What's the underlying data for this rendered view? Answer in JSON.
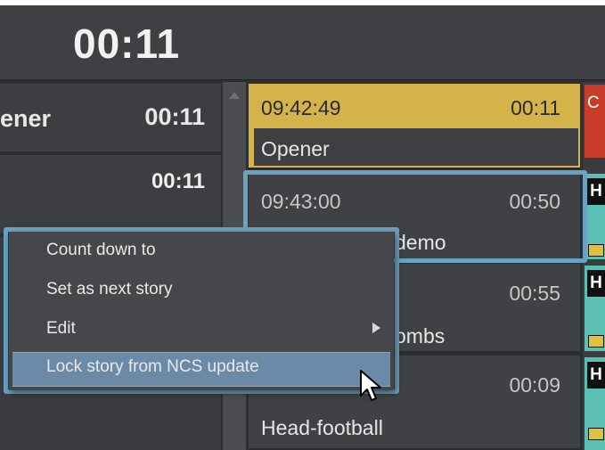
{
  "header": {
    "timer": "00:11"
  },
  "left_list": [
    {
      "name": "ener",
      "duration": "00:11"
    },
    {
      "name": "",
      "duration": "00:11"
    }
  ],
  "stories": [
    {
      "time": "09:42:49",
      "duration": "00:11",
      "name": "Opener"
    },
    {
      "time": "09:43:00",
      "duration": "00:50",
      "name": "demo"
    },
    {
      "time": "",
      "duration": "00:55",
      "name": "ombs"
    },
    {
      "time": "",
      "duration": "00:09",
      "name": "Head-football"
    }
  ],
  "right_tags": [
    "H",
    "H",
    "H"
  ],
  "red_block_label": "C",
  "context_menu": {
    "items": [
      {
        "label": "Count down to"
      },
      {
        "label": "Set as next story"
      },
      {
        "label": "Edit"
      },
      {
        "label": "Lock story from NCS update"
      }
    ],
    "highlighted_index": 3
  },
  "colors": {
    "accent": "#6aa2c4",
    "active_story": "#d4b44a",
    "menu_highlight": "#6b8aa8",
    "red_block": "#c83d2a"
  },
  "icons": {
    "scroll_up": "triangle-up",
    "submenu": "triangle-right",
    "cursor": "arrow-pointer"
  }
}
